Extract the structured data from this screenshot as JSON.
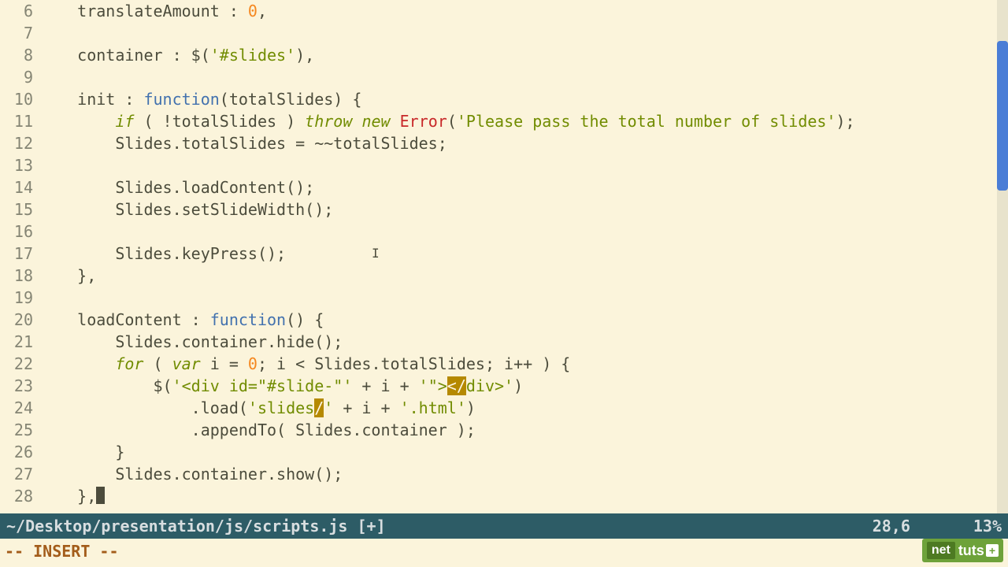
{
  "gutter": [
    "6",
    "7",
    "8",
    "9",
    "10",
    "11",
    "12",
    "13",
    "14",
    "15",
    "16",
    "17",
    "18",
    "19",
    "20",
    "21",
    "22",
    "23",
    "24",
    "25",
    "26",
    "27",
    "28"
  ],
  "lines": {
    "l6_a": "    translateAmount : ",
    "l6_b": "0",
    "l6_c": ",",
    "l7": "",
    "l8_a": "    container : $(",
    "l8_b": "'#slides'",
    "l8_c": "),",
    "l9": "",
    "l10_a": "    init : ",
    "l10_b": "function",
    "l10_c": "(totalSlides) {",
    "l11_a": "        ",
    "l11_b": "if",
    "l11_c": " ( !totalSlides ) ",
    "l11_d": "throw",
    "l11_e": " ",
    "l11_f": "new",
    "l11_g": " ",
    "l11_h": "Error",
    "l11_i": "(",
    "l11_j": "'Please pass the total number of slides'",
    "l11_k": ");",
    "l12": "        Slides.totalSlides = ~~totalSlides;",
    "l13": "",
    "l14": "        Slides.loadContent();",
    "l15": "        Slides.setSlideWidth();",
    "l16": "",
    "l17": "        Slides.keyPress();",
    "l18": "    },",
    "l19": "",
    "l20_a": "    loadContent : ",
    "l20_b": "function",
    "l20_c": "() {",
    "l21": "        Slides.container.hide();",
    "l22_a": "        ",
    "l22_b": "for",
    "l22_c": " ( ",
    "l22_d": "var",
    "l22_e": " i = ",
    "l22_f": "0",
    "l22_g": "; i < Slides.totalSlides; i++ ) {",
    "l23_a": "            $(",
    "l23_b": "'<div id=\"#slide-\"'",
    "l23_c": " + i + ",
    "l23_d": "'\">",
    "l23_e": "<",
    "l23_f": "/",
    "l23_g": "div>'",
    "l23_h": ")",
    "l24_a": "                .load(",
    "l24_b": "'slides",
    "l24_c": "/",
    "l24_d": "'",
    "l24_e": " + i + ",
    "l24_f": "'.html'",
    "l24_g": ")",
    "l25": "                .appendTo( Slides.container );",
    "l26": "        }",
    "l27": "        Slides.container.show();",
    "l28": "    },"
  },
  "status": {
    "path": "~/Desktop/presentation/js/scripts.js [+]",
    "position": "28,6",
    "percent": "13%"
  },
  "mode": "-- INSERT --",
  "logo": {
    "net": "net",
    "tuts": "tuts",
    "plus": "+"
  },
  "text_cursor_glyph": "I"
}
